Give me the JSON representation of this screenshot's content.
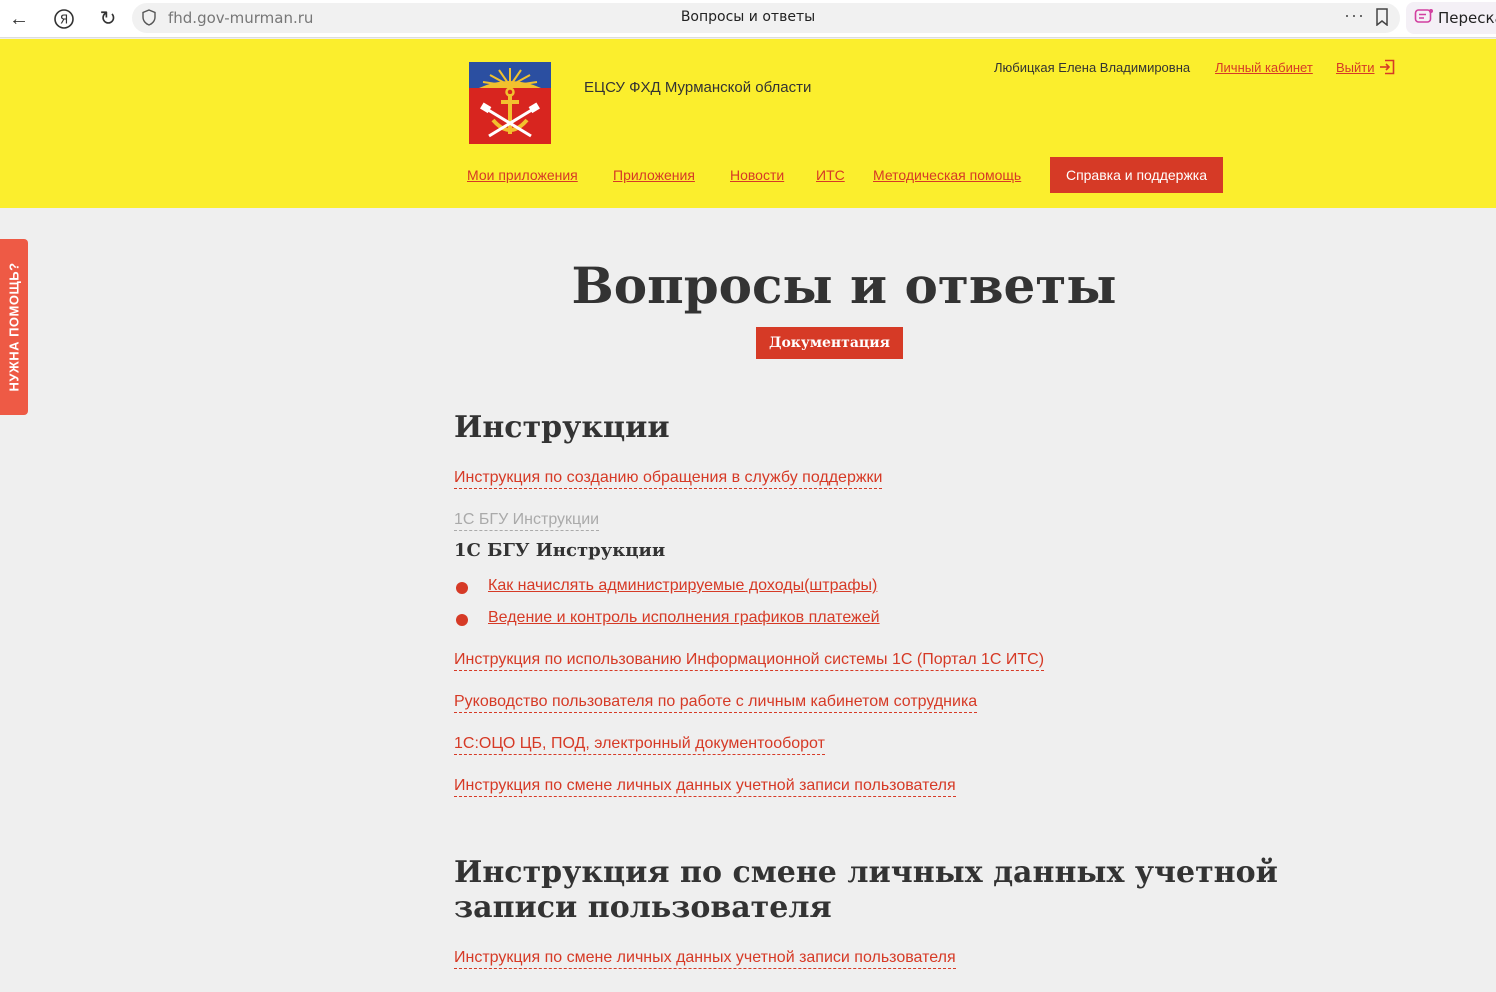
{
  "browser": {
    "url": "fhd.gov-murman.ru",
    "tab_title": "Вопросы и ответы",
    "more": "···",
    "retell_label": "Перескажи"
  },
  "header": {
    "site_name": "ЕЦСУ ФХД Мурманской области",
    "user_name": "Любицкая Елена Владимировна",
    "cabinet_link": "Личный кабинет",
    "logout_link": "Выйти",
    "nav": [
      "Мои приложения",
      "Приложения",
      "Новости",
      "ИТС",
      "Методическая помощь"
    ],
    "nav_active": "Справка и поддержка"
  },
  "help_tab": "НУЖНА ПОМОЩЬ?",
  "main": {
    "title": "Вопросы и ответы",
    "doc_button": "Документация",
    "section1": {
      "heading": "Инструкции",
      "link1": "Инструкция по созданию обращения в службу поддержки",
      "muted_link": "1С БГУ Инструкции",
      "subheading": "1С БГУ Инструкции",
      "bullets": [
        "Как начислять администрируемые доходы(штрафы)",
        "Ведение и контроль исполнения графиков платежей"
      ],
      "links": [
        "Инструкция по использованию Информационной системы 1С (Портал 1С ИТС)",
        "Руководство пользователя по работе с личным кабинетом сотрудника",
        "1С:ОЦО ЦБ, ПОД, электронный документооборот",
        "Инструкция по смене личных данных учетной записи пользователя"
      ]
    },
    "section2": {
      "heading_line1": "Инструкция по смене личных данных учетной",
      "heading_line2": "записи пользователя",
      "link": "Инструкция по смене личных данных учетной записи пользователя"
    }
  }
}
